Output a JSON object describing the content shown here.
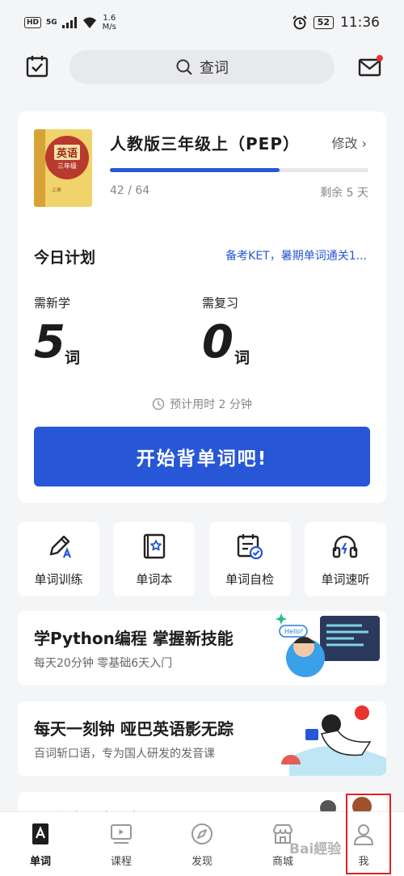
{
  "status_bar": {
    "hd": "HD",
    "net": "5G",
    "speed_top": "1.6",
    "speed_bottom": "M/s",
    "battery": "52",
    "time": "11:36"
  },
  "header": {
    "search_label": "查词",
    "left_icon": "calendar-check-icon",
    "right_icon": "mail-icon"
  },
  "book": {
    "cover_title": "英语",
    "cover_grade": "三年级",
    "cover_vol": "上册",
    "title": "人教版三年级上（PEP）",
    "edit_label": "修改 ›",
    "progress_count": "42 / 64",
    "progress_fraction": 0.656,
    "remain": "剩余 5 天"
  },
  "plan": {
    "title": "今日计划",
    "link": "备考KET，暑期单词通关1...",
    "new_label": "需新学",
    "new_count": "5",
    "review_label": "需复习",
    "review_count": "0",
    "unit": "词",
    "estimate": "预计用时 2 分钟",
    "start_button": "开始背单词吧!"
  },
  "tiles": [
    {
      "label": "单词训练",
      "icon": "pencil-icon"
    },
    {
      "label": "单词本",
      "icon": "notebook-star-icon"
    },
    {
      "label": "单词自检",
      "icon": "calendar-check-icon"
    },
    {
      "label": "单词速听",
      "icon": "headphones-icon"
    }
  ],
  "promos": [
    {
      "title": "学Python编程 掌握新技能",
      "subtitle": "每天20分钟 零基础6天入门",
      "art_text": "Hello!"
    },
    {
      "title": "每天一刻钟 哑巴英语影无踪",
      "subtitle": "百词斩口语，专为国人研发的发音课"
    },
    {
      "title": "听说读写全面提升",
      "subtitle": ""
    }
  ],
  "nav": [
    {
      "label": "单词",
      "icon": "word-book-icon",
      "active": true
    },
    {
      "label": "课程",
      "icon": "video-course-icon"
    },
    {
      "label": "发现",
      "icon": "compass-icon"
    },
    {
      "label": "商城",
      "icon": "shop-icon"
    },
    {
      "label": "我",
      "icon": "person-icon"
    }
  ],
  "watermark": "Bai經验",
  "colors": {
    "accent": "#2757d6",
    "highlight": "#e02020"
  }
}
